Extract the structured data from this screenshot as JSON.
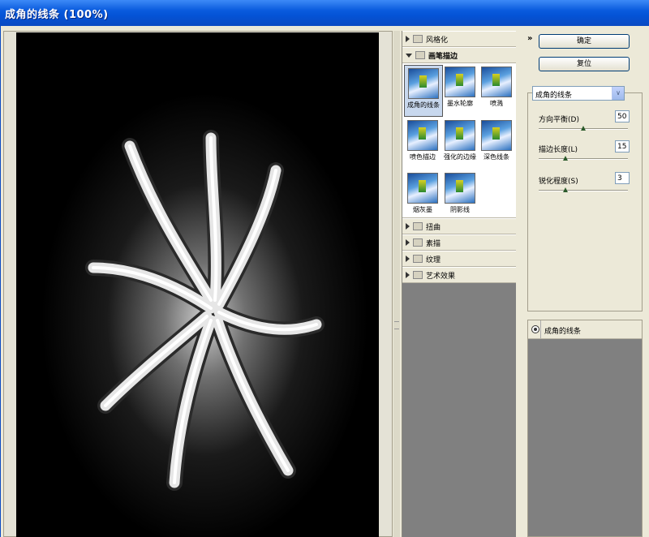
{
  "window": {
    "title": "成角的线条 (100%)"
  },
  "gallery": {
    "folders_top": [
      {
        "label": "风格化",
        "open": false
      },
      {
        "label": "画笔描边",
        "open": true
      }
    ],
    "thumbnails": [
      {
        "label": "成角的线条",
        "selected": true
      },
      {
        "label": "墨水轮廓",
        "selected": false
      },
      {
        "label": "喷溅",
        "selected": false
      },
      {
        "label": "喷色描边",
        "selected": false
      },
      {
        "label": "强化的边缘",
        "selected": false
      },
      {
        "label": "深色线条",
        "selected": false
      },
      {
        "label": "烟灰墨",
        "selected": false
      },
      {
        "label": "阴影线",
        "selected": false
      }
    ],
    "folders_bottom": [
      {
        "label": "扭曲"
      },
      {
        "label": "素描"
      },
      {
        "label": "纹理"
      },
      {
        "label": "艺术效果"
      }
    ]
  },
  "buttons": {
    "ok": "确定",
    "reset": "复位"
  },
  "filter_select": {
    "value": "成角的线条"
  },
  "params": [
    {
      "label": "方向平衡(D)",
      "value": "50",
      "fraction": 0.5
    },
    {
      "label": "描边长度(L)",
      "value": "15",
      "fraction": 0.3
    },
    {
      "label": "锐化程度(S)",
      "value": "3",
      "fraction": 0.3
    }
  ],
  "layers": [
    {
      "label": "成角的线条"
    }
  ]
}
